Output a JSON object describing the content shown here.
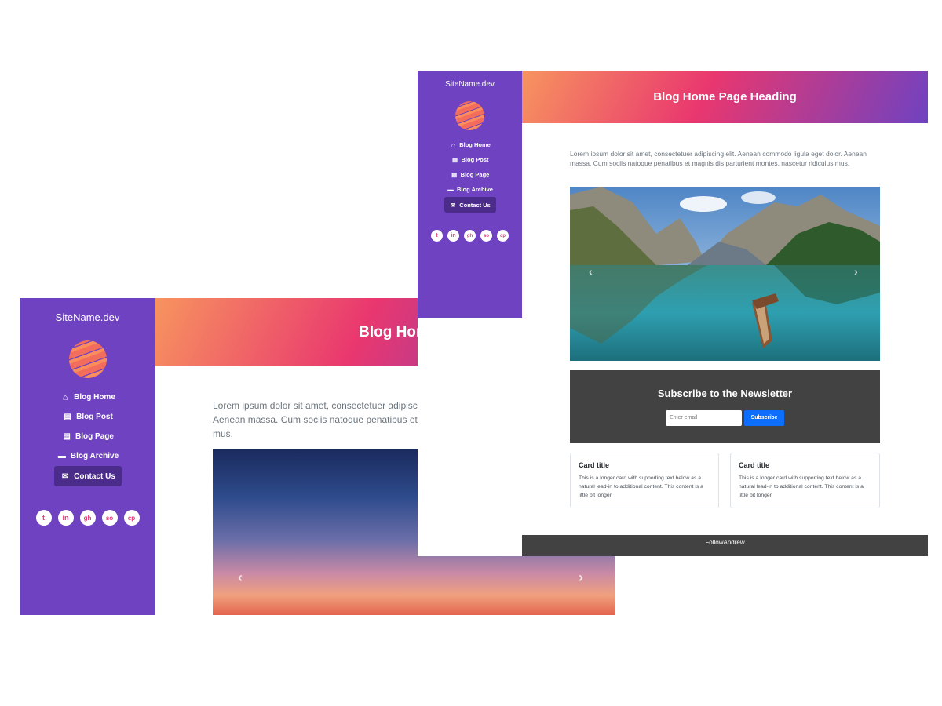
{
  "site": {
    "name": "SiteName.dev"
  },
  "nav": [
    {
      "label": "Blog Home",
      "icon": "home-icon"
    },
    {
      "label": "Blog Post",
      "icon": "file-icon"
    },
    {
      "label": "Blog Page",
      "icon": "file-text-icon"
    },
    {
      "label": "Blog Archive",
      "icon": "archive-icon"
    },
    {
      "label": "Contact Us",
      "icon": "envelope-icon"
    }
  ],
  "socials": [
    {
      "name": "twitter-icon",
      "glyph": "t"
    },
    {
      "name": "linkedin-icon",
      "glyph": "in"
    },
    {
      "name": "github-icon",
      "glyph": "gh"
    },
    {
      "name": "stackoverflow-icon",
      "glyph": "so"
    },
    {
      "name": "codepen-icon",
      "glyph": "cp"
    }
  ],
  "header": {
    "title": "Blog Home Page Heading",
    "title_truncated": "Blog Home Pa"
  },
  "intro": {
    "text": "Lorem ipsum dolor sit amet, consectetuer adipiscing elit. Aenean commodo ligula eget dolor. Aenean massa. Cum sociis natoque penatibus et magnis dis parturient montes, nascetur ridiculus mus.",
    "line1_truncated": "Lorem ipsum dolor sit amet, consectetuer adipiscin",
    "line2_truncated": "Aenean massa. Cum sociis natoque penatibus et m",
    "line3_truncated": "mus."
  },
  "carousel": {
    "prev": "‹",
    "next": "›"
  },
  "newsletter": {
    "title": "Subscribe to the Newsletter",
    "placeholder": "Enter email",
    "button": "Subscribe"
  },
  "cards": [
    {
      "title": "Card title",
      "text": "This is a longer card with supporting text below as a natural lead-in to additional content. This content is a little bit longer."
    },
    {
      "title": "Card title",
      "text": "This is a longer card with supporting text below as a natural lead-in to additional content. This content is a little bit longer."
    }
  ],
  "footer": {
    "text": "FollowAndrew"
  },
  "colors": {
    "sidebar": "#6f42c1",
    "accent_pink": "#e9376f",
    "accent_orange": "#f7945f",
    "newsletter_bg": "#424242",
    "button_blue": "#0d6efd"
  }
}
